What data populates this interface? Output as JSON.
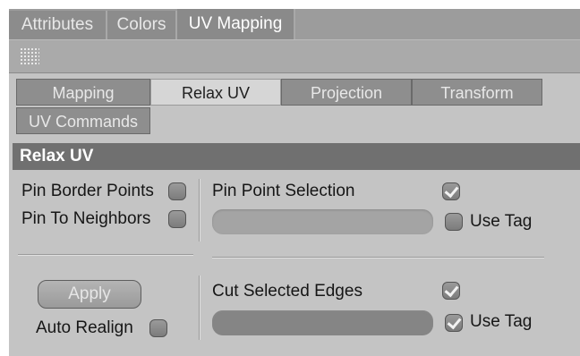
{
  "top_tabs": [
    {
      "label": "Attributes",
      "active": false
    },
    {
      "label": "Colors",
      "active": false
    },
    {
      "label": "UV Mapping",
      "active": true
    }
  ],
  "toolbar": {
    "icon": "grip-icon"
  },
  "sub_tabs": [
    {
      "label": "Mapping",
      "active": false
    },
    {
      "label": "Relax UV",
      "active": true
    },
    {
      "label": "Projection",
      "active": false
    },
    {
      "label": "Transform",
      "active": false
    },
    {
      "label": "UV Commands",
      "active": false
    }
  ],
  "section": {
    "title": "Relax UV"
  },
  "options": {
    "pin_border_points": {
      "label": "Pin Border Points",
      "checked": false
    },
    "pin_to_neighbors": {
      "label": "Pin To Neighbors",
      "checked": false
    },
    "pin_point_selection": {
      "label": "Pin Point Selection",
      "checked": true,
      "field_value": "",
      "use_tag_label": "Use Tag",
      "use_tag_checked": false
    },
    "cut_selected_edges": {
      "label": "Cut Selected Edges",
      "checked": true,
      "field_value": "",
      "use_tag_label": "Use Tag",
      "use_tag_checked": true
    },
    "apply_label": "Apply",
    "auto_realign": {
      "label": "Auto Realign",
      "checked": false
    }
  }
}
